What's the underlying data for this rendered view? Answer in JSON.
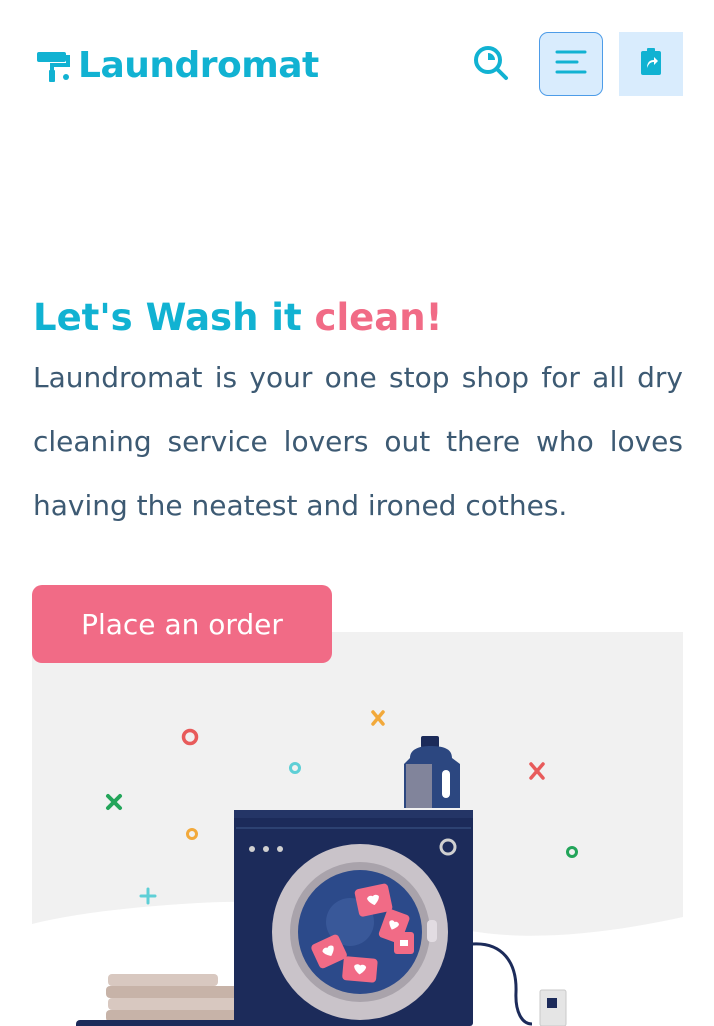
{
  "header": {
    "brand_name": "Laundromat",
    "icons": {
      "logo": "paint-roller-icon",
      "search": "search-icon",
      "menu": "menu-icon",
      "share": "clipboard-share-icon"
    }
  },
  "hero": {
    "title_main": "Let's Wash it ",
    "title_accent": "clean!",
    "description": "Laundromat is your one stop shop for all dry cleaning service lovers out there who loves having the neatest and ironed cothes.",
    "cta_label": "Place an order"
  },
  "colors": {
    "brand": "#11b2d2",
    "accent": "#f16b86",
    "text": "#3d5a73",
    "button_bg": "#d9ecfd",
    "machine": "#1c2b5a"
  }
}
